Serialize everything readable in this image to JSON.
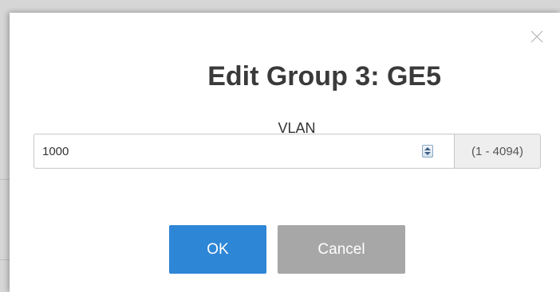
{
  "dialog": {
    "title": "Edit Group 3: GE5",
    "close_icon": "close-icon"
  },
  "vlan": {
    "label": "VLAN",
    "value": "1000",
    "range": "(1 - 4094)",
    "spinner_icon": "spinner-icon"
  },
  "buttons": {
    "ok_label": "OK",
    "cancel_label": "Cancel"
  },
  "colors": {
    "ok_bg": "#2e86d6",
    "cancel_bg": "#a7a7a7",
    "title_text": "#3a3a3a"
  }
}
